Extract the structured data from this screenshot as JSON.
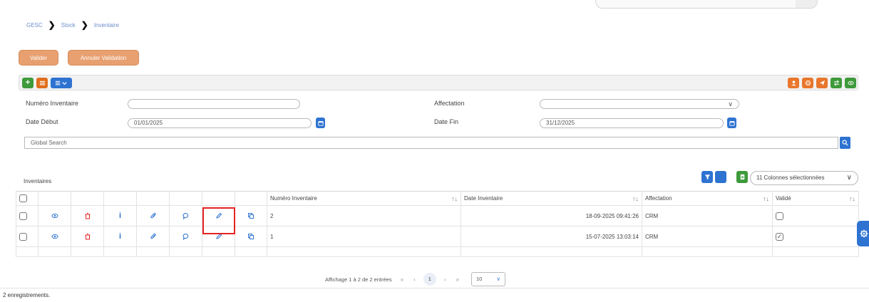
{
  "breadcrumb": [
    "GESC",
    "Stock",
    "Inventaire"
  ],
  "actions": {
    "valider": "Valider",
    "annuler": "Annuler Validation"
  },
  "form": {
    "numero_label": "Numéro Inventaire",
    "numero_value": "",
    "affectation_label": "Affectation",
    "affectation_value": "",
    "date_debut_label": "Date Début",
    "date_debut_value": "01/01/2025",
    "date_fin_label": "Date Fin",
    "date_fin_value": "31/12/2025",
    "global_search_placeholder": "Global Search"
  },
  "table": {
    "title": "Inventaires",
    "columns_select": "11 Colonnes sélectionnées",
    "headers": [
      "Numéro Inventaire",
      "Date Inventaire",
      "Affectation",
      "Validé"
    ],
    "rows": [
      {
        "numero": "2",
        "date": "18-09-2025 09:41:26",
        "affectation": "CRM",
        "valide": false
      },
      {
        "numero": "1",
        "date": "15-07-2025 13:03:14",
        "affectation": "CRM",
        "valide": true
      }
    ]
  },
  "pager": {
    "summary": "Affichage 1 à 2 de 2 entrées",
    "current_page": "1",
    "page_size": "10"
  },
  "footer": "2 enregistrements.",
  "colors": {
    "orange": "#e8a070",
    "blue": "#2e73d1",
    "green": "#3e9a3a",
    "highlight": "#e52222"
  }
}
